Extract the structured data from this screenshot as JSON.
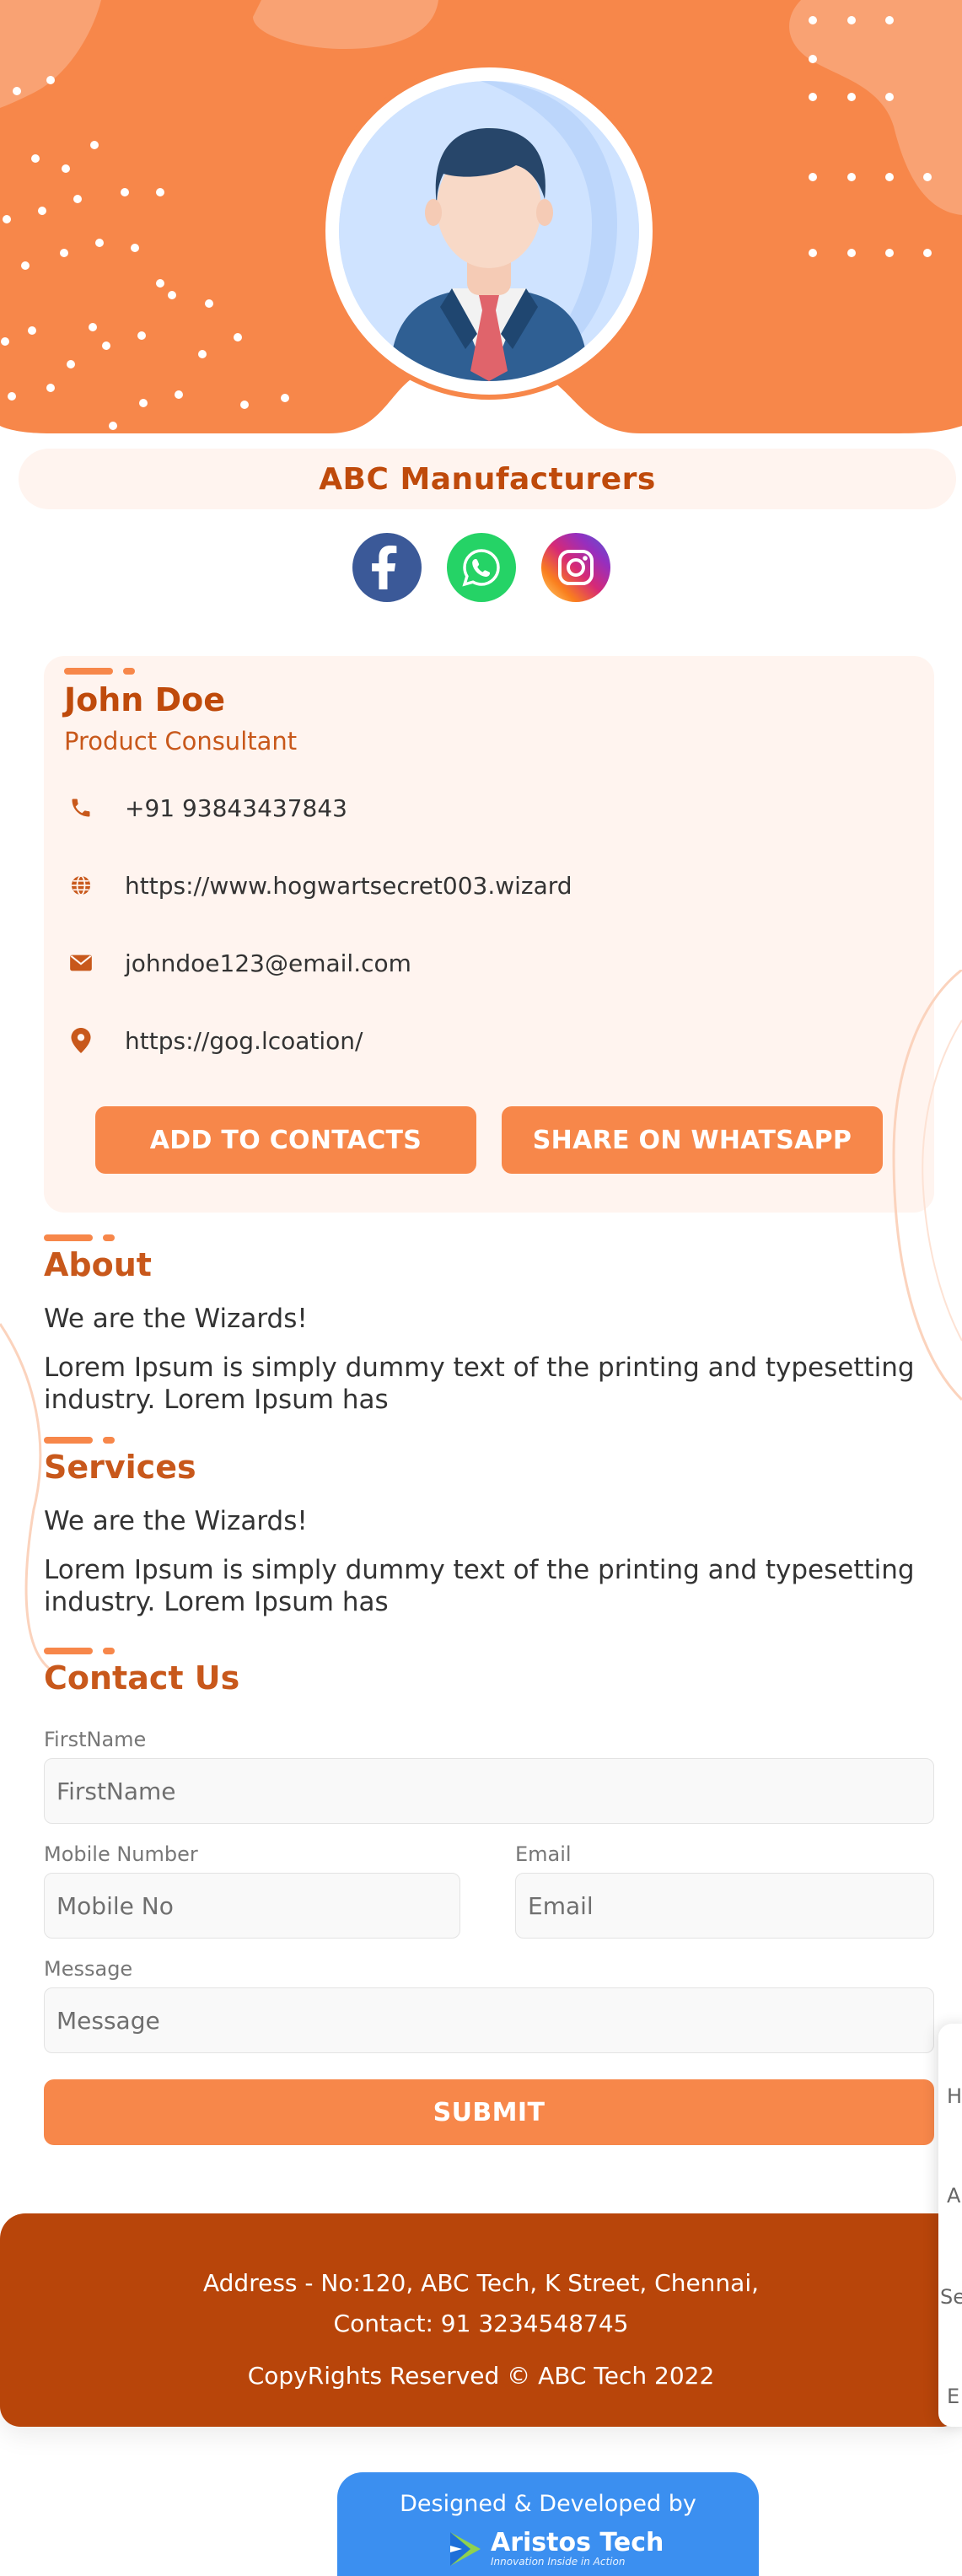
{
  "header": {
    "company_name": "ABC Manufacturers"
  },
  "social": [
    {
      "name": "facebook-icon",
      "color": "#3b5998"
    },
    {
      "name": "whatsapp-icon",
      "color": "#25d366"
    },
    {
      "name": "instagram-icon",
      "color": "#d62976"
    }
  ],
  "profile": {
    "name": "John Doe",
    "title": "Product Consultant",
    "phone": "+91 93843437843",
    "website": "https://www.hogwartsecret003.wizard",
    "email": "johndoe123@email.com",
    "location": "https://gog.lcoation/"
  },
  "actions": {
    "add_contacts": "ADD TO CONTACTS",
    "share_whatsapp": "SHARE ON WHATSAPP"
  },
  "about": {
    "title": "About",
    "tagline": "We are the Wizards!",
    "body": "Lorem Ipsum is simply dummy text of the printing and typesetting industry. Lorem Ipsum has"
  },
  "services": {
    "title": "Services",
    "tagline": "We are the Wizards!",
    "body": "Lorem Ipsum is simply dummy text of the printing and typesetting industry. Lorem Ipsum has"
  },
  "contact_form": {
    "title": "Contact Us",
    "firstname_label": "FirstName",
    "firstname_placeholder": "FirstName",
    "mobile_label": "Mobile Number",
    "mobile_placeholder": "Mobile No",
    "email_label": "Email",
    "email_placeholder": "Email",
    "message_label": "Message",
    "message_placeholder": "Message",
    "submit_label": "SUBMIT"
  },
  "footer": {
    "address": "Address - No:120, ABC Tech, K Street, Chennai,",
    "contact": "Contact: 91 3234548745",
    "copyright": "CopyRights Reserved © ABC Tech 2022"
  },
  "developer": {
    "label": "Designed & Developed by",
    "brand": "Aristos Tech",
    "tagline": "Innovation Inside in Action"
  },
  "side_panel": {
    "items": [
      "H",
      "A",
      "Se",
      "E"
    ]
  },
  "colors": {
    "accent": "#f7874a",
    "dark_accent": "#b8450a",
    "panel_bg": "#fff4ef",
    "developer_bg": "#3b8ff0"
  }
}
